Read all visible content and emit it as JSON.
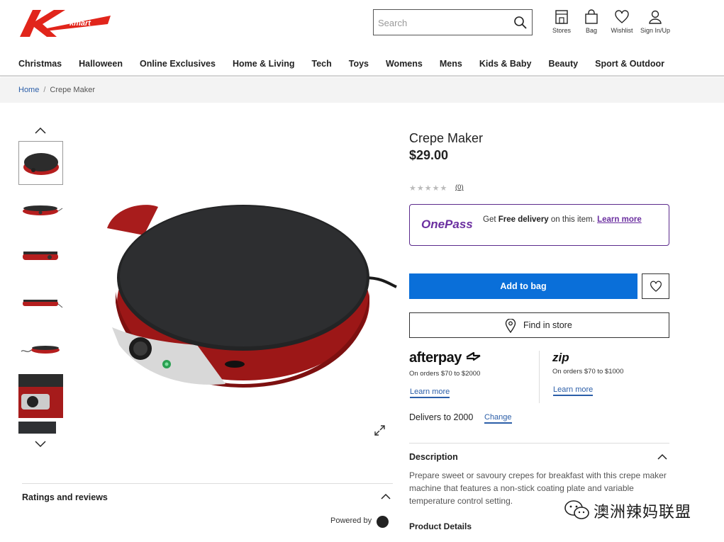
{
  "header": {
    "search_placeholder": "Search",
    "icons": [
      {
        "label": "Stores",
        "icon": "store-icon"
      },
      {
        "label": "Bag",
        "icon": "bag-icon"
      },
      {
        "label": "Wishlist",
        "icon": "heart-icon"
      },
      {
        "label": "Sign In/Up",
        "icon": "user-icon"
      }
    ],
    "logo_text": "kmart"
  },
  "nav": {
    "items": [
      "Christmas",
      "Halloween",
      "Online Exclusives",
      "Home & Living",
      "Tech",
      "Toys",
      "Womens",
      "Mens",
      "Kids & Baby",
      "Beauty",
      "Sport & Outdoor"
    ]
  },
  "breadcrumb": {
    "home": "Home",
    "separator": "/",
    "current": "Crepe Maker"
  },
  "gallery": {
    "thumb_count": 7,
    "selected_index": 0
  },
  "reviews": {
    "title": "Ratings and reviews",
    "powered_by": "Powered by"
  },
  "product": {
    "title": "Crepe Maker",
    "price": "$29.00",
    "stars": "★★★★★",
    "rating_count": "(0)",
    "onepass": {
      "logo": "OnePass",
      "text_before": "Get ",
      "text_bold": "Free delivery",
      "text_after": " on this item. ",
      "learn_more": "Learn more"
    },
    "add_to_bag": "Add to bag",
    "find_in_store": "Find in store",
    "afterpay": {
      "logo": "afterpay",
      "note": "On orders $70 to $2000",
      "learn_more": "Learn more"
    },
    "zip": {
      "logo": "zip",
      "note": "On orders $70 to $1000",
      "learn_more": "Learn more"
    },
    "delivers_to": "Delivers to 2000",
    "change": "Change",
    "description_title": "Description",
    "description_text": "Prepare sweet or savoury crepes for breakfast with this crepe maker machine that features a non-stick coating plate and variable temperature control setting.",
    "product_details_title": "Product Details"
  },
  "watermark": {
    "text": "澳洲辣妈联盟"
  },
  "colors": {
    "brand_red": "#e1251b",
    "primary_blue": "#0a6fd9",
    "onepass_purple": "#6b2fa0",
    "link_blue": "#2b5ea8"
  }
}
